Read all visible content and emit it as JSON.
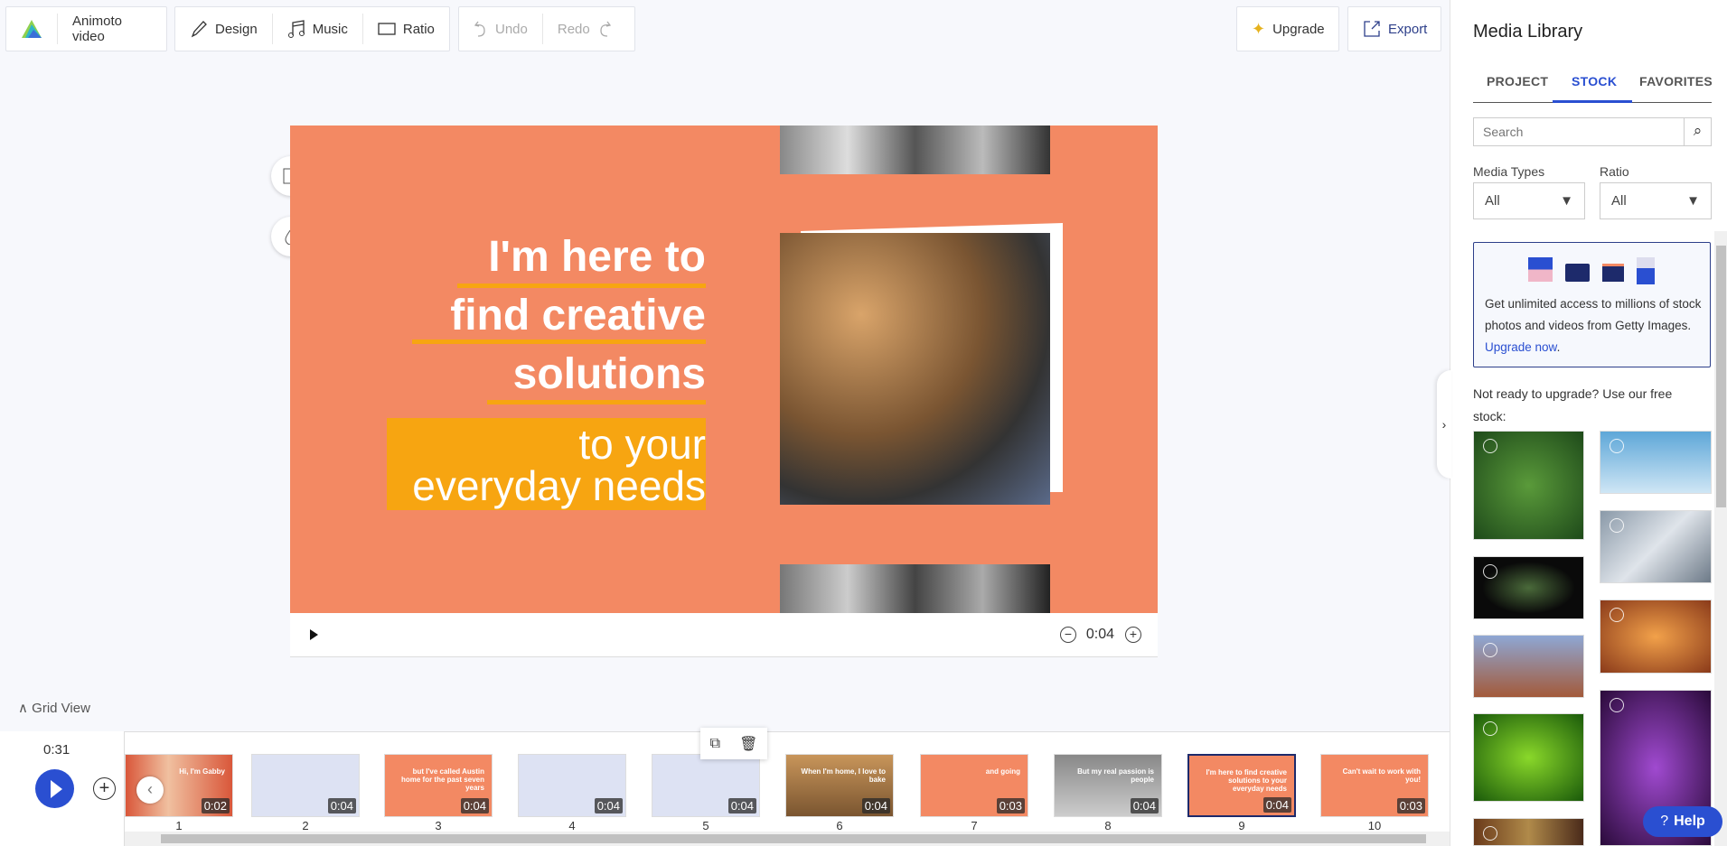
{
  "toolbar": {
    "project_name": "Animoto video",
    "design": "Design",
    "music": "Music",
    "ratio": "Ratio",
    "undo": "Undo",
    "redo": "Redo",
    "upgrade": "Upgrade",
    "export": "Export"
  },
  "preview": {
    "lines": [
      "I'm here to",
      "find creative",
      "solutions",
      "to your",
      "everyday needs"
    ],
    "duration": "0:04",
    "bg_color": "#f38963",
    "highlight_color": "#f7a511"
  },
  "timeline": {
    "grid_view": "Grid View",
    "total_time": "0:31",
    "slides": [
      {
        "num": "1",
        "dur": "0:02",
        "text": "Hi, I'm Gabby"
      },
      {
        "num": "2",
        "dur": "0:04",
        "text": ""
      },
      {
        "num": "3",
        "dur": "0:04",
        "text": "but I've called Austin home for the past seven years"
      },
      {
        "num": "4",
        "dur": "0:04",
        "text": ""
      },
      {
        "num": "5",
        "dur": "0:04",
        "text": ""
      },
      {
        "num": "6",
        "dur": "0:04",
        "text": "When I'm home, I love to bake"
      },
      {
        "num": "7",
        "dur": "0:03",
        "text": "and going"
      },
      {
        "num": "8",
        "dur": "0:04",
        "text": "But my real passion is people"
      },
      {
        "num": "9",
        "dur": "0:04",
        "text": "I'm here to find creative solutions to your everyday needs"
      },
      {
        "num": "10",
        "dur": "0:03",
        "text": "Can't wait to work with you!"
      }
    ]
  },
  "sidebar": {
    "title": "Media Library",
    "tabs": [
      "PROJECT",
      "STOCK",
      "FAVORITES"
    ],
    "active_tab": "STOCK",
    "search_placeholder": "Search",
    "media_types_label": "Media Types",
    "media_types_value": "All",
    "ratio_label": "Ratio",
    "ratio_value": "All",
    "promo_text": "Get unlimited access to millions of stock photos and videos from Getty Images. ",
    "promo_link": "Upgrade now",
    "promo_end": ".",
    "free_text": "Not ready to upgrade? Use our free stock:",
    "help": "Help",
    "accent": "#2a4fd1"
  }
}
